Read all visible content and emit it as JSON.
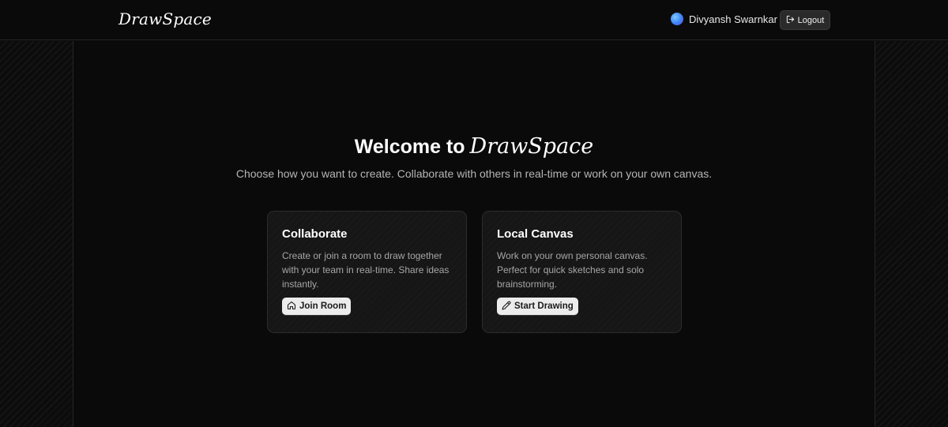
{
  "header": {
    "logo": "DrawSpace",
    "user_name": "Divyansh Swarnkar",
    "logout_label": "Logout"
  },
  "hero": {
    "title_prefix": "Welcome to",
    "title_brand": "DrawSpace",
    "subtitle": "Choose how you want to create. Collaborate with others in real-time or work on your own canvas."
  },
  "cards": {
    "collaborate": {
      "title": "Collaborate",
      "description": "Create or join a room to draw together with your team in real-time. Share ideas instantly.",
      "button_label": "Join Room",
      "button_icon": "home-icon"
    },
    "local": {
      "title": "Local Canvas",
      "description": "Work on your own personal canvas. Perfect for quick sketches and solo brainstorming.",
      "button_label": "Start Drawing",
      "button_icon": "pencil-icon"
    }
  },
  "colors": {
    "background": "#0a0a0a",
    "card": "#161616",
    "button_light": "#ececec",
    "button_dark": "#2a2a2a",
    "avatar_accent": "#3b82f6"
  }
}
